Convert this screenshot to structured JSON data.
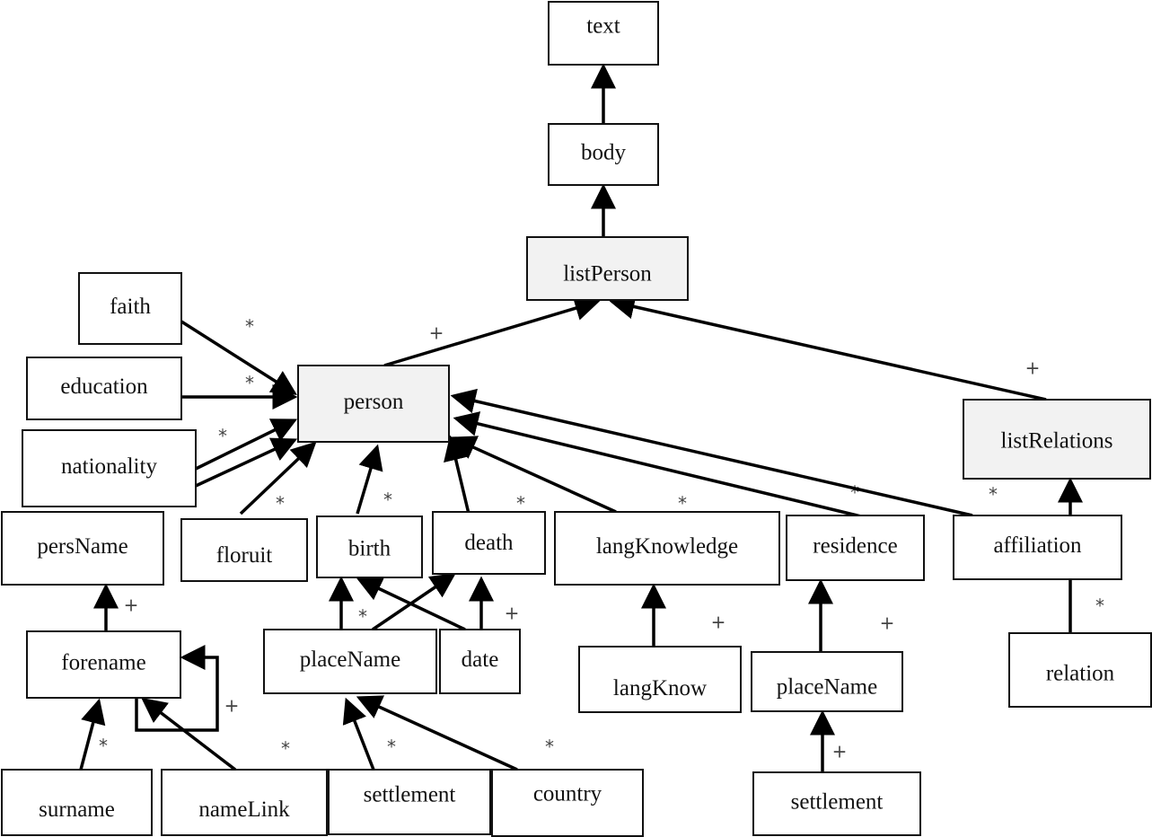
{
  "colors": {
    "highlight_fill": "#f2f2f2",
    "plain_fill": "#ffffff",
    "stroke": "#111111"
  },
  "nodes": [
    {
      "id": "text",
      "label": "text",
      "highlight": false
    },
    {
      "id": "body",
      "label": "body",
      "highlight": false
    },
    {
      "id": "listPerson",
      "label": "listPerson",
      "highlight": true
    },
    {
      "id": "faith",
      "label": "faith",
      "highlight": false
    },
    {
      "id": "education",
      "label": "education",
      "highlight": false
    },
    {
      "id": "nationality",
      "label": "nationality",
      "highlight": false
    },
    {
      "id": "person",
      "label": "person",
      "highlight": true
    },
    {
      "id": "listRelations",
      "label": "listRelations",
      "highlight": true
    },
    {
      "id": "persName",
      "label": "persName",
      "highlight": false
    },
    {
      "id": "floruit",
      "label": "floruit",
      "highlight": false
    },
    {
      "id": "birth",
      "label": "birth",
      "highlight": false
    },
    {
      "id": "death",
      "label": "death",
      "highlight": false
    },
    {
      "id": "langKnowledge",
      "label": "langKnowledge",
      "highlight": false
    },
    {
      "id": "residence",
      "label": "residence",
      "highlight": false
    },
    {
      "id": "affiliation",
      "label": "affiliation",
      "highlight": false
    },
    {
      "id": "forename",
      "label": "forename",
      "highlight": false
    },
    {
      "id": "placeName1",
      "label": "placeName",
      "highlight": false
    },
    {
      "id": "date",
      "label": "date",
      "highlight": false
    },
    {
      "id": "langKnow",
      "label": "langKnow",
      "highlight": false
    },
    {
      "id": "placeName2",
      "label": "placeName",
      "highlight": false
    },
    {
      "id": "relation",
      "label": "relation",
      "highlight": false
    },
    {
      "id": "surname",
      "label": "surname",
      "highlight": false
    },
    {
      "id": "nameLink",
      "label": "nameLink",
      "highlight": false
    },
    {
      "id": "settlement1",
      "label": "settlement",
      "highlight": false
    },
    {
      "id": "country",
      "label": "country",
      "highlight": false
    },
    {
      "id": "settlement2",
      "label": "settlement",
      "highlight": false
    }
  ],
  "edges": [
    {
      "from": "body",
      "to": "text",
      "mult": ""
    },
    {
      "from": "listPerson",
      "to": "body",
      "mult": ""
    },
    {
      "from": "person",
      "to": "listPerson",
      "mult": "+"
    },
    {
      "from": "listRelations",
      "to": "listPerson",
      "mult": "+"
    },
    {
      "from": "faith",
      "to": "person",
      "mult": "*"
    },
    {
      "from": "education",
      "to": "person",
      "mult": "*"
    },
    {
      "from": "nationality",
      "to": "person",
      "mult": "*"
    },
    {
      "from": "nationality",
      "to": "person",
      "mult": ""
    },
    {
      "from": "floruit",
      "to": "person",
      "mult": "*"
    },
    {
      "from": "birth",
      "to": "person",
      "mult": "*"
    },
    {
      "from": "death",
      "to": "person",
      "mult": "*"
    },
    {
      "from": "langKnowledge",
      "to": "person",
      "mult": "*"
    },
    {
      "from": "residence",
      "to": "person",
      "mult": "*"
    },
    {
      "from": "affiliation",
      "to": "person",
      "mult": "*"
    },
    {
      "from": "affiliation",
      "to": "listRelations",
      "mult": ""
    },
    {
      "from": "relation",
      "to": "affiliation",
      "mult": "*",
      "arrow": false
    },
    {
      "from": "forename",
      "to": "persName",
      "mult": "+"
    },
    {
      "from": "placeName1",
      "to": "birth",
      "mult": "*"
    },
    {
      "from": "placeName1",
      "to": "death",
      "mult": ""
    },
    {
      "from": "date",
      "to": "birth",
      "mult": ""
    },
    {
      "from": "date",
      "to": "death",
      "mult": "+"
    },
    {
      "from": "langKnow",
      "to": "langKnowledge",
      "mult": "+"
    },
    {
      "from": "placeName2",
      "to": "residence",
      "mult": "+"
    },
    {
      "from": "settlement2",
      "to": "placeName2",
      "mult": "+"
    },
    {
      "from": "surname",
      "to": "forename",
      "mult": "*"
    },
    {
      "from": "nameLink",
      "to": "forename",
      "mult": "*"
    },
    {
      "from": "forename",
      "to": "forename",
      "mult": "+"
    },
    {
      "from": "settlement1",
      "to": "placeName1",
      "mult": "*"
    },
    {
      "from": "country",
      "to": "placeName1",
      "mult": "*"
    }
  ]
}
